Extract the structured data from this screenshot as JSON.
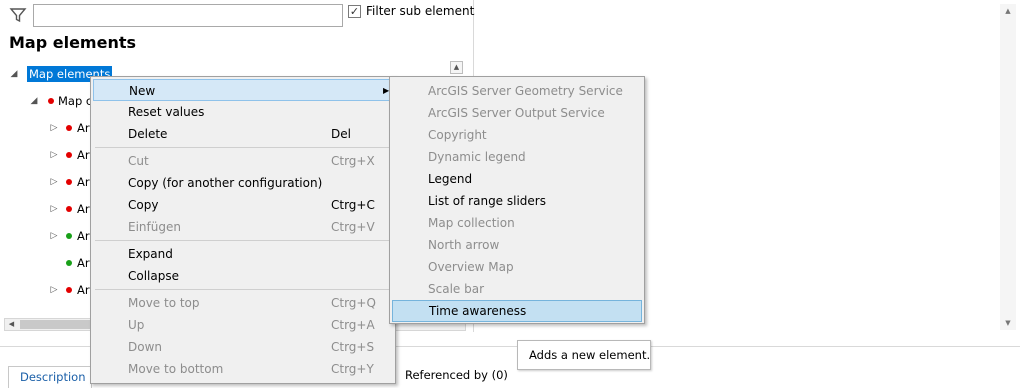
{
  "filter": {
    "icon": "filter-icon",
    "input_value": "",
    "checkbox_checked": true,
    "checkbox_label": "Filter sub elements"
  },
  "left_pane": {
    "title": "Map elements"
  },
  "tree": {
    "root_label": "Map elements",
    "child_label": "Map c",
    "items": [
      {
        "label": "Ar",
        "dot": "red"
      },
      {
        "label": "Ar",
        "dot": "red"
      },
      {
        "label": "Ar",
        "dot": "red"
      },
      {
        "label": "Ar",
        "dot": "red"
      },
      {
        "label": "Ar",
        "dot": "green"
      },
      {
        "label": "Ar",
        "dot": "green"
      },
      {
        "label": "Ar",
        "dot": "red"
      }
    ]
  },
  "context_menu": {
    "items": [
      {
        "label": "New",
        "shortcut": "",
        "state": "active",
        "submenu": true
      },
      {
        "label": "Reset values",
        "shortcut": "",
        "state": "enabled"
      },
      {
        "label": "Delete",
        "shortcut": "Del",
        "state": "enabled"
      },
      {
        "label": "Cut",
        "shortcut": "Ctrg+X",
        "state": "disabled"
      },
      {
        "label": "Copy (for another configuration)",
        "shortcut": "",
        "state": "enabled"
      },
      {
        "label": "Copy",
        "shortcut": "Ctrg+C",
        "state": "enabled"
      },
      {
        "label": "Einfügen",
        "shortcut": "Ctrg+V",
        "state": "disabled"
      },
      {
        "label": "Expand",
        "shortcut": "",
        "state": "enabled"
      },
      {
        "label": "Collapse",
        "shortcut": "",
        "state": "enabled"
      },
      {
        "label": "Move to top",
        "shortcut": "Ctrg+Q",
        "state": "disabled"
      },
      {
        "label": "Up",
        "shortcut": "Ctrg+A",
        "state": "disabled"
      },
      {
        "label": "Down",
        "shortcut": "Ctrg+S",
        "state": "disabled"
      },
      {
        "label": "Move to bottom",
        "shortcut": "Ctrg+Y",
        "state": "disabled"
      }
    ]
  },
  "submenu": {
    "items": [
      {
        "label": "ArcGIS Server Geometry Service",
        "state": "disabled"
      },
      {
        "label": "ArcGIS Server Output Service",
        "state": "disabled"
      },
      {
        "label": "Copyright",
        "state": "disabled"
      },
      {
        "label": "Dynamic legend",
        "state": "disabled"
      },
      {
        "label": "Legend",
        "state": "enabled"
      },
      {
        "label": "List of range sliders",
        "state": "enabled"
      },
      {
        "label": "Map collection",
        "state": "disabled"
      },
      {
        "label": "North arrow",
        "state": "disabled"
      },
      {
        "label": "Overview Map",
        "state": "disabled"
      },
      {
        "label": "Scale bar",
        "state": "disabled"
      },
      {
        "label": "Time awareness",
        "state": "highlighted"
      }
    ]
  },
  "tooltip": {
    "text": "Adds a new element."
  },
  "bottom_tabs": {
    "description": "Description",
    "referenced_by": "Referenced by (0)"
  },
  "colors": {
    "selection": "#0078d7",
    "menu_bg": "#f0f0f0",
    "menu_highlight": "#c3e0f2",
    "dot_red": "#e30000",
    "dot_green": "#19a019"
  }
}
